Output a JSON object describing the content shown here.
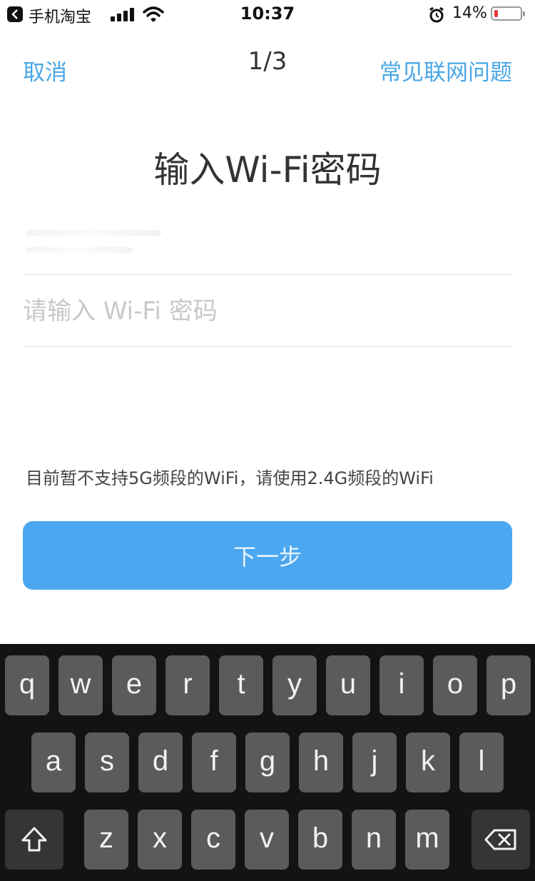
{
  "status_bar": {
    "back_app": "手机淘宝",
    "time": "10:37",
    "battery_percent": "14%",
    "battery_level": 0.14,
    "battery_color": "#e53935",
    "icons": [
      "chevron-left-icon",
      "signal-icon",
      "wifi-icon",
      "alarm-icon",
      "battery-icon"
    ]
  },
  "nav": {
    "cancel": "取消",
    "step": "1/3",
    "faq": "常见联网问题",
    "accent_color": "#4aa7e6"
  },
  "title": "输入Wi-Fi密码",
  "password": {
    "value": "",
    "placeholder": "请输入 Wi-Fi 密码"
  },
  "notice": "目前暂不支持5G频段的WiFi，请使用2.4G频段的WiFi",
  "next_button": {
    "label": "下一步",
    "color": "#4aa7f0"
  },
  "keyboard": {
    "row1": [
      "q",
      "w",
      "e",
      "r",
      "t",
      "y",
      "u",
      "i",
      "o",
      "p"
    ],
    "row2": [
      "a",
      "s",
      "d",
      "f",
      "g",
      "h",
      "j",
      "k",
      "l"
    ],
    "row3": [
      "z",
      "x",
      "c",
      "v",
      "b",
      "n",
      "m"
    ],
    "shift_icon": "shift-icon",
    "delete_icon": "backspace-icon"
  }
}
